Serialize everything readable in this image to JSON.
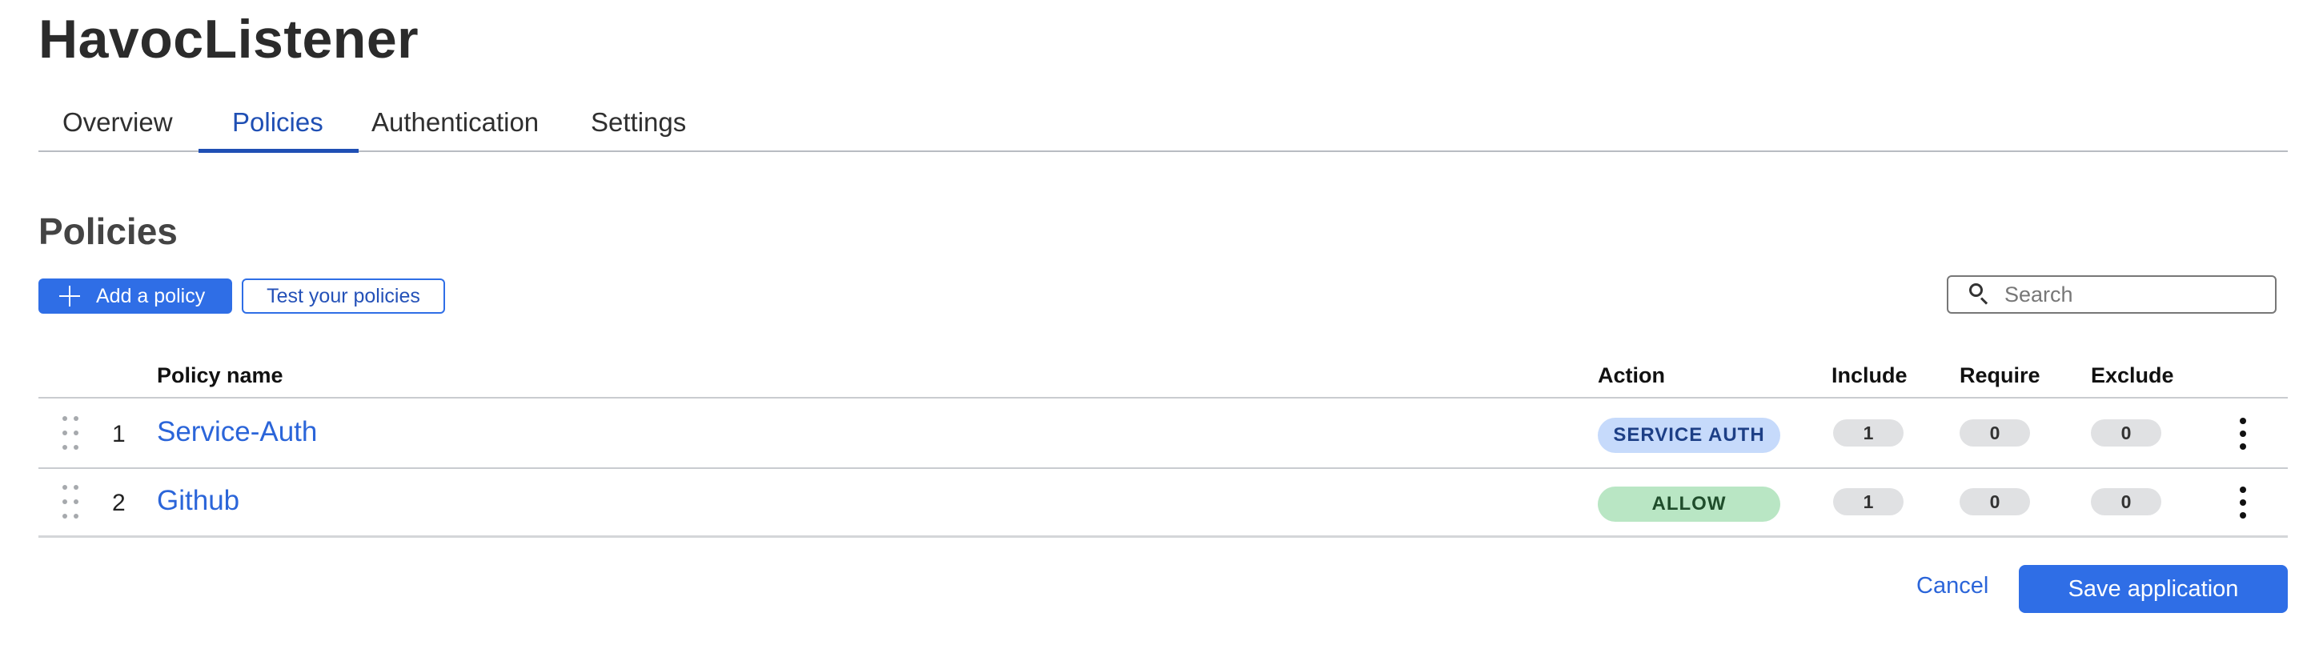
{
  "app": {
    "title": "HavocListener"
  },
  "tabs": [
    {
      "label": "Overview",
      "active": false
    },
    {
      "label": "Policies",
      "active": true
    },
    {
      "label": "Authentication",
      "active": false
    },
    {
      "label": "Settings",
      "active": false
    }
  ],
  "section": {
    "title": "Policies"
  },
  "toolbar": {
    "add_label": "Add a policy",
    "test_label": "Test your policies",
    "search_placeholder": "Search"
  },
  "table": {
    "columns": {
      "name": "Policy name",
      "action": "Action",
      "include": "Include",
      "require": "Require",
      "exclude": "Exclude"
    },
    "rows": [
      {
        "num": "1",
        "name": "Service-Auth",
        "action": "SERVICE AUTH",
        "include": "1",
        "require": "0",
        "exclude": "0"
      },
      {
        "num": "2",
        "name": "Github",
        "action": "ALLOW",
        "include": "1",
        "require": "0",
        "exclude": "0"
      }
    ]
  },
  "footer": {
    "cancel_label": "Cancel",
    "save_label": "Save application"
  },
  "colors": {
    "accent": "#2f6ee6",
    "link": "#2b65d9",
    "badge_service_auth_bg": "#c6dafb",
    "badge_service_auth_text": "#1d3f86",
    "badge_allow_bg": "#b9e6c4",
    "badge_allow_text": "#1f4d2b"
  }
}
